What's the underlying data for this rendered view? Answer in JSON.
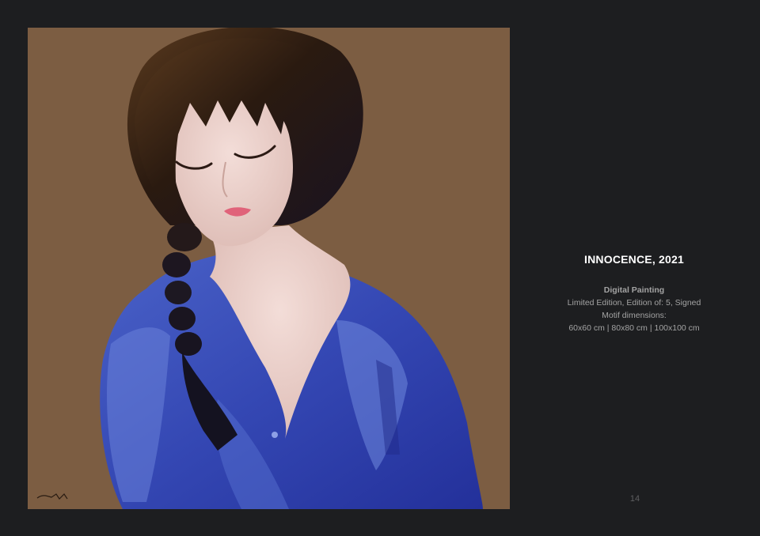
{
  "artwork": {
    "title": "INNOCENCE, 2021",
    "medium": "Digital Painting",
    "edition": "Limited Edition, Edition of: 5, Signed",
    "dimensions_label": "Motif dimensions:",
    "dimensions": "60x60 cm | 80x80 cm | 100x100 cm"
  },
  "page": {
    "number": "14"
  },
  "colors": {
    "page_background": "#1d1e20",
    "canvas_background": "#7c5d42",
    "title": "#ffffff",
    "body_text": "#a3a3a3",
    "page_number": "#5e5e60"
  }
}
